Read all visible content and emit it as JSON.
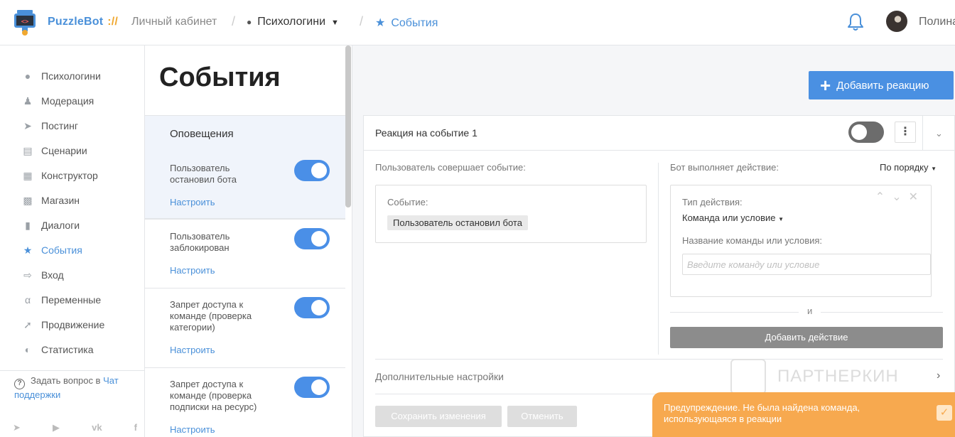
{
  "header": {
    "brand": "PuzzleBot",
    "brand_sep": "://",
    "crumb_cabinet": "Личный кабинет",
    "crumb_project": "Психологини",
    "crumb_page": "События",
    "username": "Полина"
  },
  "sidebar": {
    "items": [
      {
        "label": "Психологини",
        "icon": "cake-icon"
      },
      {
        "label": "Модерация",
        "icon": "users-icon"
      },
      {
        "label": "Постинг",
        "icon": "send-icon"
      },
      {
        "label": "Сценарии",
        "icon": "scenario-icon"
      },
      {
        "label": "Конструктор",
        "icon": "grid-icon"
      },
      {
        "label": "Магазин",
        "icon": "cart-icon"
      },
      {
        "label": "Диалоги",
        "icon": "chat-icon"
      },
      {
        "label": "События",
        "icon": "star-icon"
      },
      {
        "label": "Вход",
        "icon": "login-icon"
      },
      {
        "label": "Переменные",
        "icon": "variables-icon"
      },
      {
        "label": "Продвижение",
        "icon": "rocket-icon"
      },
      {
        "label": "Статистика",
        "icon": "pie-chart-icon"
      }
    ],
    "help_text": "Задать вопрос в",
    "help_link": "Чат поддержки"
  },
  "events": {
    "title": "События",
    "section": "Оповещения",
    "setup_label": "Настроить",
    "items": [
      {
        "label": "Пользователь остановил бота",
        "enabled": true
      },
      {
        "label": "Пользователь заблокирован",
        "enabled": true
      },
      {
        "label": "Запрет доступа к команде (проверка категории)",
        "enabled": true
      },
      {
        "label": "Запрет доступа к команде (проверка подписки на ресурс)",
        "enabled": true
      }
    ]
  },
  "main": {
    "add_reaction": "Добавить реакцию",
    "reaction_title": "Реакция на событие 1",
    "reaction_enabled": false,
    "user_event_label": "Пользователь совершает событие:",
    "bot_action_label": "Бот выполняет действие:",
    "order_select": "По порядку",
    "event_label": "Событие:",
    "event_value": "Пользователь остановил бота",
    "action_type_label": "Тип действия:",
    "action_type_value": "Команда или условие",
    "command_name_label": "Название команды или условия:",
    "command_placeholder": "Введите команду или условие",
    "and_text": "и",
    "add_action": "Добавить действие",
    "extra_settings": "Дополнительные настройки",
    "save": "Сохранить изменения",
    "cancel": "Отменить"
  },
  "watermark": "ПАРТНЕРКИН",
  "toast": {
    "text": "Предупреждение. Не была найдена команда, использующаяся в реакции",
    "color": "#f7a94f"
  },
  "colors": {
    "accent": "#4a90d9",
    "toggle_on": "#4a8fe7",
    "warning": "#f7a94f"
  }
}
